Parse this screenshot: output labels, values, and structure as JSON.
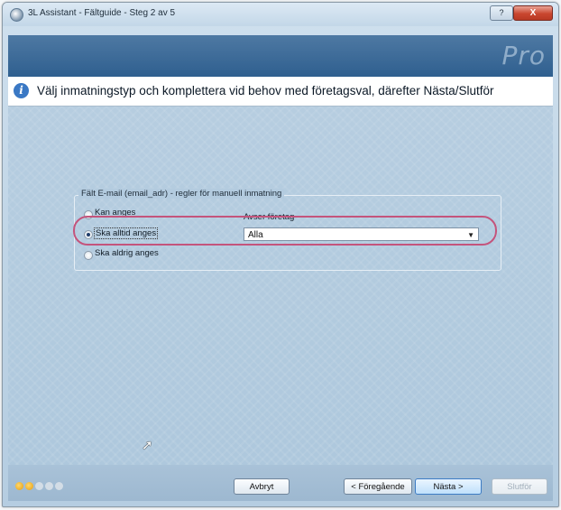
{
  "window": {
    "title": "3L Assistant - Fältguide - Steg 2 av 5"
  },
  "titlebar": {
    "help_label": "?",
    "close_label": "X"
  },
  "banner": {
    "logo": "Pro"
  },
  "info": {
    "text": "Välj inmatningstyp och komplettera vid behov med företagsval, därefter Nästa/Slutför"
  },
  "group": {
    "title": "Fält E-mail (email_adr) - regler för manuell inmatning",
    "options": [
      {
        "label": "Kan anges",
        "selected": false
      },
      {
        "label": "Ska alltid anges",
        "selected": true
      },
      {
        "label": "Ska aldrig anges",
        "selected": false
      }
    ],
    "company_label": "Avser företag",
    "company_value": "Alla"
  },
  "footer": {
    "progress": {
      "completed": 2,
      "total": 5
    },
    "cancel": "Avbryt",
    "previous": "< Föregående",
    "next": "Nästa >",
    "finish": "Slutför"
  }
}
